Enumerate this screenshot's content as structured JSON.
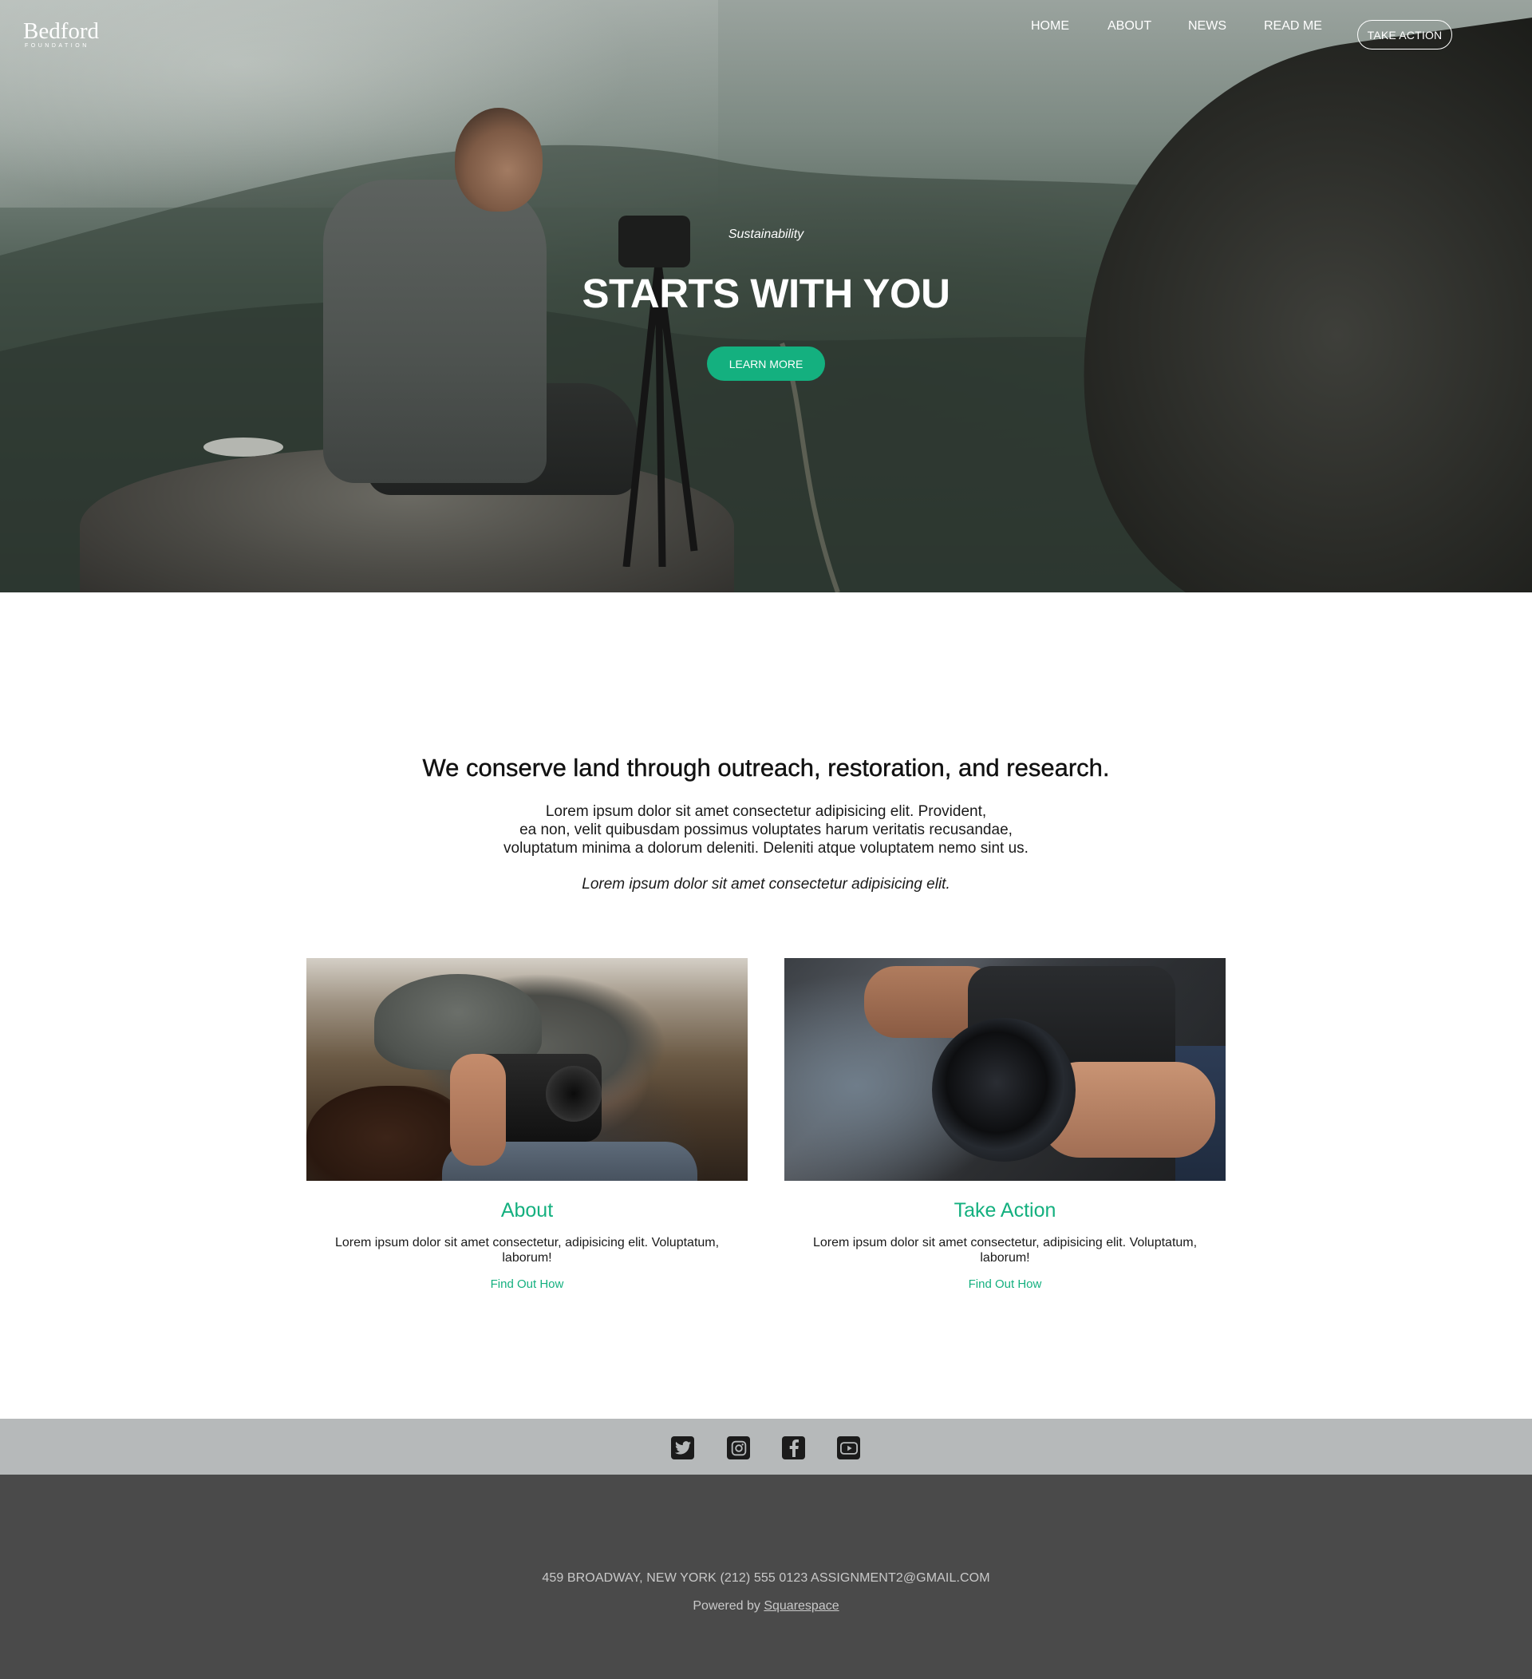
{
  "header": {
    "logo_word": "Bedford",
    "logo_sub": "FOUNDATION",
    "nav": [
      {
        "label": "HOME"
      },
      {
        "label": "ABOUT"
      },
      {
        "label": "NEWS"
      },
      {
        "label": "READ ME"
      }
    ],
    "cta_label": "TAKE ACTION"
  },
  "hero": {
    "kicker": "Sustainability",
    "title": "STARTS WITH YOU",
    "button_label": "LEARN MORE"
  },
  "intro": {
    "heading": "We conserve land through outreach, restoration, and research.",
    "body_lines": [
      "Lorem ipsum dolor sit amet consectetur adipisicing elit. Provident,",
      "ea non, velit quibusdam possimus voluptates harum veritatis recusandae,",
      "voluptatum minima a dolorum deleniti. Deleniti atque voluptatem nemo sint us."
    ],
    "italic_line": "Lorem ipsum dolor sit amet consectetur adipisicing elit."
  },
  "cards": [
    {
      "title": "About",
      "text": "Lorem ipsum dolor sit amet consectetur, adipisicing elit. Voluptatum, laborum!",
      "link": "Find Out How"
    },
    {
      "title": "Take Action",
      "text": "Lorem ipsum dolor sit amet consectetur, adipisicing elit. Voluptatum, laborum!",
      "link": "Find Out How"
    }
  ],
  "social": {
    "icons": [
      "twitter-icon",
      "instagram-icon",
      "facebook-icon",
      "youtube-icon"
    ]
  },
  "footer": {
    "address": "459 BROADWAY, NEW YORK (212) 555 0123 ASSIGNMENT2@GMAIL.COM",
    "powered_prefix": "Powered by",
    "powered_link": "Squarespace"
  },
  "colors": {
    "accent": "#14b07f",
    "social_bar": "#b6b9ba",
    "footer_bg": "#4a4a4a"
  }
}
